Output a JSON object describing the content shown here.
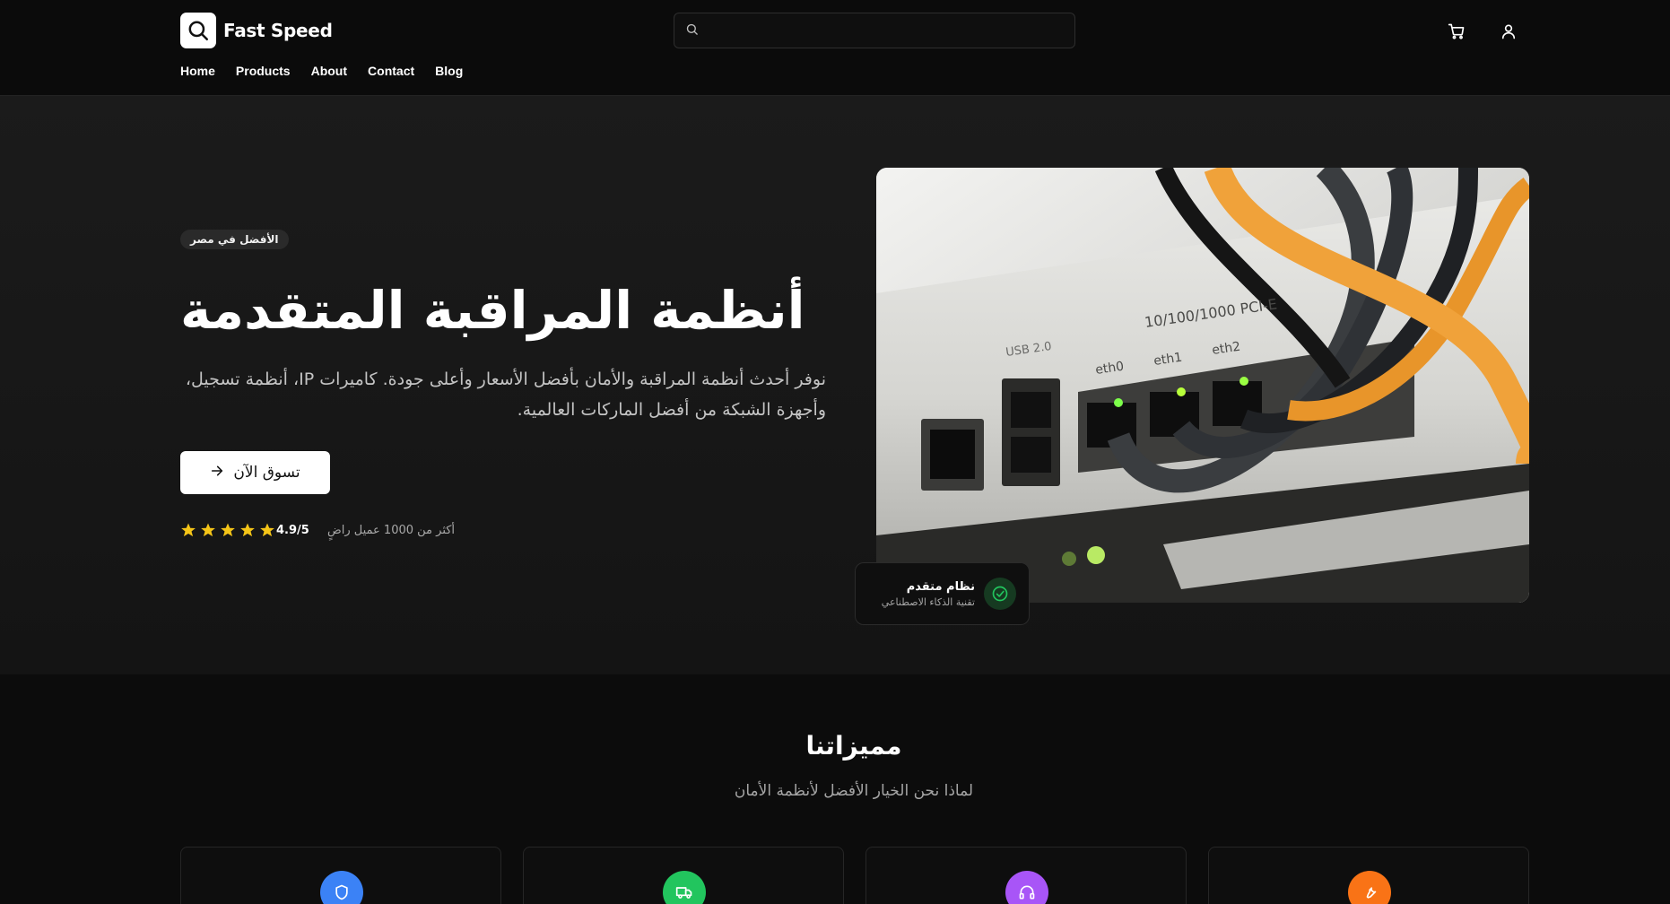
{
  "header": {
    "brand": "Fast Speed",
    "search": {
      "value": "",
      "placeholder": ""
    },
    "nav": [
      {
        "label": "Home"
      },
      {
        "label": "Products"
      },
      {
        "label": "About"
      },
      {
        "label": "Contact"
      },
      {
        "label": "Blog"
      }
    ],
    "icons": [
      "search-icon",
      "cart-icon",
      "user-icon"
    ]
  },
  "hero": {
    "badge": "الأفضل في مصر",
    "title": "أنظمة المراقبة المتقدمة",
    "description": "نوفر أحدث أنظمة المراقبة والأمان بأفضل الأسعار وأعلى جودة. كاميرات IP، أنظمة تسجيل، وأجهزة الشبكة من أفضل الماركات العالمية.",
    "cta_label": "تسوق الآن",
    "rating": {
      "value_text": "4.9/5",
      "stars": 5,
      "star_color": "#f5c518"
    },
    "customers_text": "أكثر من 1000 عميل راضٍ",
    "image_alt": "network switch with cables",
    "float_card": {
      "title": "نظام متقدم",
      "subtitle": "تقنية الذكاء الاصطناعي",
      "accent": "#22c55e"
    }
  },
  "features": {
    "title": "مميزاتنا",
    "subtitle": "لماذا نحن الخيار الأفضل لأنظمة الأمان",
    "cards": [
      {
        "icon": "shield-icon",
        "color": "#3b82f6"
      },
      {
        "icon": "truck-icon",
        "color": "#22c55e"
      },
      {
        "icon": "headphones-icon",
        "color": "#a855f7"
      },
      {
        "icon": "wrench-icon",
        "color": "#f97316"
      }
    ]
  }
}
